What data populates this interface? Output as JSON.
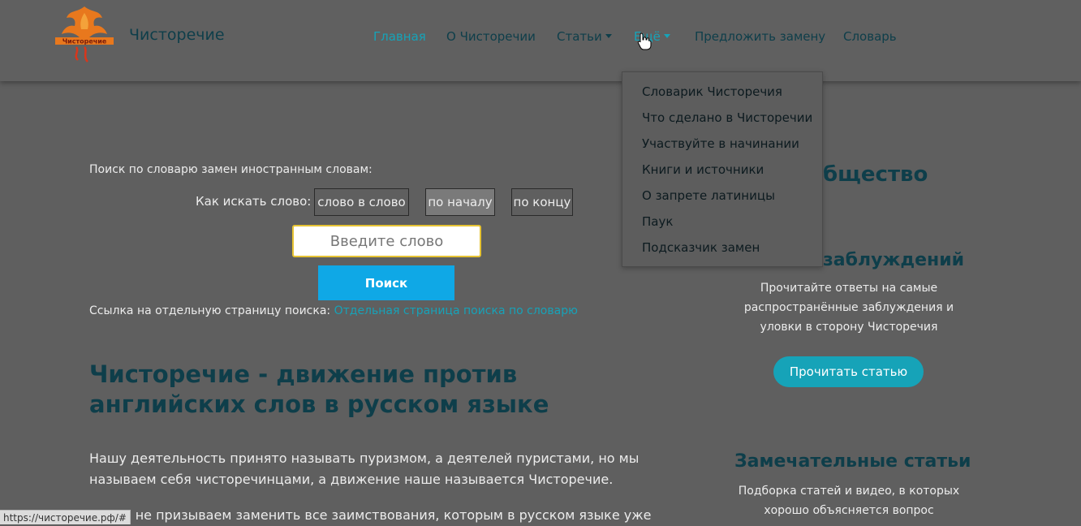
{
  "site": {
    "brand": "Чисторечие",
    "logo_text": "Чисторечие"
  },
  "nav": {
    "items": [
      {
        "label": "Главная",
        "active": true
      },
      {
        "label": "О Чисторечии"
      },
      {
        "label": "Статьи",
        "has_caret": true
      },
      {
        "label": "Ещё",
        "has_caret": true,
        "active": true
      },
      {
        "label": "Предложить замену"
      },
      {
        "label": "Словарь"
      }
    ]
  },
  "dropdown": {
    "items": [
      "Словарик Чисторечия",
      "Что сделано в Чисторечии",
      "Участвуйте в начинании",
      "Книги и источники",
      "О запрете латиницы",
      "Паук",
      "Подсказчик замен"
    ]
  },
  "search": {
    "label": "Поиск по словарю замен иностранным словам:",
    "mode_label": "Как искать слово:",
    "modes": [
      "слово в слово",
      "по началу",
      "по концу"
    ],
    "selected_mode": "по началу",
    "placeholder": "Введите слово",
    "value": "",
    "button": "Поиск",
    "link_prefix": "Ссылка на отдельную страницу поиска:",
    "link_text": "Отдельная страница поиска по словарю"
  },
  "article": {
    "title": "Чисторечие - движение против английских слов в русском языке",
    "p1": "Нашу деятельность принято называть пуризмом, а деятелей пуристами, но мы называем себя чисторечинцами, а движение наше называется Чисторечие.",
    "p2": "Но мы не призываем заменить все заимствования, которым в русском языке уже"
  },
  "sidebar": {
    "partial_heading_1": "бщество",
    "partial_heading_2": "заблуждений",
    "text1": "Прочитайте ответы на самые распространённые заблуждения и уловки в сторону Чисторечия",
    "button": "Прочитать статью",
    "heading3": "Замечательные статьи",
    "text3": "Подборка статей и видео, в которых хорошо объясняется вопрос"
  },
  "status_bar": {
    "url": "https://чисторечие.рф/#"
  },
  "colors": {
    "accent": "#16a3b8",
    "heading": "#0e3e4a",
    "search_button": "#0fa8e6",
    "input_border": "#e6c333"
  }
}
